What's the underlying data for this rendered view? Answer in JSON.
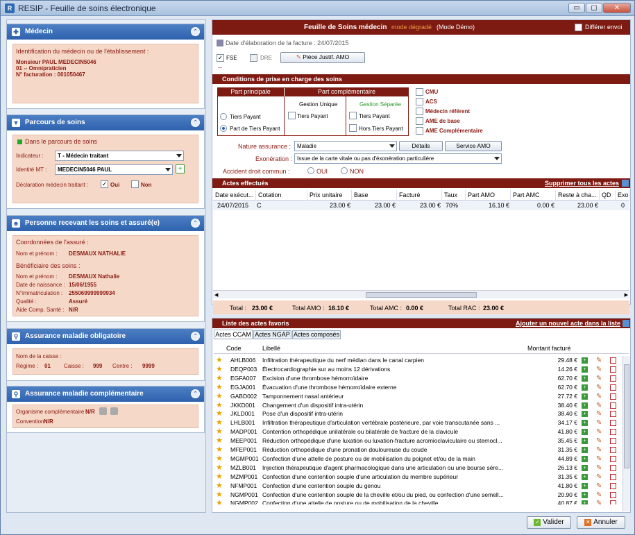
{
  "window": {
    "title": "RESIP - Feuille de soins électronique",
    "min": "▭",
    "max": "▢",
    "close": "✕"
  },
  "medecin": {
    "title": "Médecin",
    "identification_title": "Identification du médecin ou de l'établissement :",
    "name": "Monsieur PAUL MEDECIN5046",
    "speciality": "01 -- Omnipraticien",
    "facturation": "N° facturation : 001050467"
  },
  "parcours": {
    "title": "Parcours de soins",
    "status": "Dans le parcours de soins",
    "indicateur_label": "Indicateur :",
    "indicateur_value": "T - Médecin traitant",
    "identite_label": "Identité MT :",
    "identite_value": "MEDECIN5046 PAUL",
    "declaration_label": "Déclaration médecin traitant :",
    "oui": "Oui",
    "non": "Non"
  },
  "personne": {
    "title": "Personne recevant les soins et assuré(e)",
    "coord_title": "Coordonnées de l'assuré :",
    "nom_label": "Nom et prénom :",
    "nom_value": "DESMAUX NATHALIE",
    "benef_title": "Bénéficiaire des soins :",
    "benef_nom_label": "Nom et prénom :",
    "benef_nom_value": "DESMAUX Nathalie",
    "naissance_label": "Date de naissance :",
    "naissance_value": "15/06/1955",
    "immat_label": "N°immatriculation :",
    "immat_value": "255069999999934",
    "qualite_label": "Qualité :",
    "qualite_value": "Assuré",
    "acs_label": "Aide Comp. Santé :",
    "acs_value": "N/R"
  },
  "amo": {
    "title": "Assurance maladie obligatoire",
    "caisse_label": "Nom de la caisse :",
    "regime_label": "Régime :",
    "regime_value": "01",
    "caisse2_label": "Caisse :",
    "caisse2_value": "999",
    "centre_label": "Centre :",
    "centre_value": "9999"
  },
  "amc": {
    "title": "Assurance maladie complémentaire",
    "org_label": "Organisme complémentaire :",
    "org_value": "N/R",
    "conv_label": "Convention :",
    "conv_value": "N/R"
  },
  "fse": {
    "title": "Feuille de Soins médecin",
    "mode": "mode dégradé",
    "demo": "(Mode Démo)",
    "differer": "Différer envoi",
    "date_label": "Date d'élaboration de la facture : 24/07/2015",
    "fse": "FSE",
    "dre": "DRE",
    "piece": "Pièce Justif. AMO",
    "dashes": "--"
  },
  "conditions": {
    "title": "Conditions de prise en charge des soins",
    "part_principale": "Part principale",
    "part_comp": "Part complémentaire",
    "gestion_unique": "Gestion Unique",
    "gestion_separee": "Gestion Séparée",
    "tiers_payant": "Tiers Payant",
    "part_tiers": "Part de Tiers Payant",
    "tiers_payant2": "Tiers Payant",
    "tiers_payant3": "Tiers Payant",
    "hors_tiers": "Hors Tiers Payant",
    "cmu": "CMU",
    "acs": "ACS",
    "medref": "Médecin référent",
    "ame": "AME de base",
    "amecomp": "AME Complémentaire",
    "nature_label": "Nature assurance :",
    "nature_value": "Maladie",
    "details": "Détails",
    "service": "Service AMO",
    "exo_label": "Exonération :",
    "exo_value": "Issue de la carte vitale ou pas d'éxonération particulière",
    "accident_label": "Accident droit commun :",
    "oui": "OUI",
    "non": "NON"
  },
  "actes": {
    "title": "Actes effectués",
    "suppr": "Supprimer tous les actes",
    "headers": [
      "Date exécut...",
      "Cotation",
      "Prix unitaire",
      "Base",
      "Facturé",
      "Taux",
      "Part AMO",
      "Part AMC",
      "Reste à cha...",
      "QD",
      "Exo"
    ],
    "row": [
      "24/07/2015",
      "C",
      "23.00 €",
      "23.00 €",
      "23.00 €",
      "70%",
      "16.10 €",
      "0.00 €",
      "23.00 €",
      "0"
    ],
    "totals": {
      "total": "Total : ",
      "total_v": "23.00 €",
      "amo": "Total AMO : ",
      "amo_v": "16.10 €",
      "amc": "Total AMC : ",
      "amc_v": "0.00 €",
      "rac": "Total RAC : ",
      "rac_v": "23.00 €"
    }
  },
  "favoris": {
    "title": "Liste des actes favoris",
    "ajouter": "Ajouter un nouvel acte dans la liste",
    "tabs": [
      "Actes CCAM",
      "Actes NGAP",
      "Actes composés"
    ],
    "headers": {
      "code": "Code",
      "libelle": "Libellé",
      "montant": "Montant facturé"
    },
    "rows": [
      [
        "AHLB006",
        "Infiltration thérapeutique du nerf médian dans le canal carpien",
        "29.48 €"
      ],
      [
        "DEQP003",
        "Électrocardiographie sur au moins 12 dérivations",
        "14.26 €"
      ],
      [
        "EGFA007",
        "Excision d'une thrombose hémorroïdaire",
        "62.70 €"
      ],
      [
        "EGJA001",
        "Évacuation d'une thrombose hémorroïdaire externe",
        "62.70 €"
      ],
      [
        "GABD002",
        "Tamponnement nasal antérieur",
        "27.72 €"
      ],
      [
        "JKKD001",
        "Changement d'un dispositif intra-utérin",
        "38.40 €"
      ],
      [
        "JKLD001",
        "Pose d'un dispositif intra-utérin",
        "38.40 €"
      ],
      [
        "LHLB001",
        "Infiltration thérapeutique d'articulation vertébrale postérieure, par voie transcutanée sans ...",
        "34.17 €"
      ],
      [
        "MADP001",
        "Contention orthopédique unilatérale ou bilatérale de fracture de la clavicule",
        "41.80 €"
      ],
      [
        "MEEP001",
        "Réduction orthopédique d'une luxation ou luxation-fracture acromioclaviculaire ou sternocl...",
        "35.45 €"
      ],
      [
        "MFEP001",
        "Réduction orthopédique d'une pronation douloureuse du coude",
        "31.35 €"
      ],
      [
        "MGMP001",
        "Confection d'une attelle de posture ou de mobilisation du poignet et/ou de la main",
        "44.89 €"
      ],
      [
        "MZLB001",
        "Injection thérapeutique d'agent pharmacologique dans une articulation ou une bourse sére...",
        "26.13 €"
      ],
      [
        "MZMP001",
        "Confection d'une contention souple d'une articulation du membre supérieur",
        "31.35 €"
      ],
      [
        "NFMP001",
        "Confection d'une contention souple du genou",
        "41.80 €"
      ],
      [
        "NGMP001",
        "Confection d'une contention souple de la cheville et/ou du pied, ou confection d'une semell...",
        "20.90 €"
      ],
      [
        "NGMP002",
        "Confection d'une attelle de posture ou de mobilisation de la cheville",
        "40.87 €"
      ]
    ]
  },
  "footer": {
    "valider": "Valider",
    "annuler": "Annuler"
  }
}
